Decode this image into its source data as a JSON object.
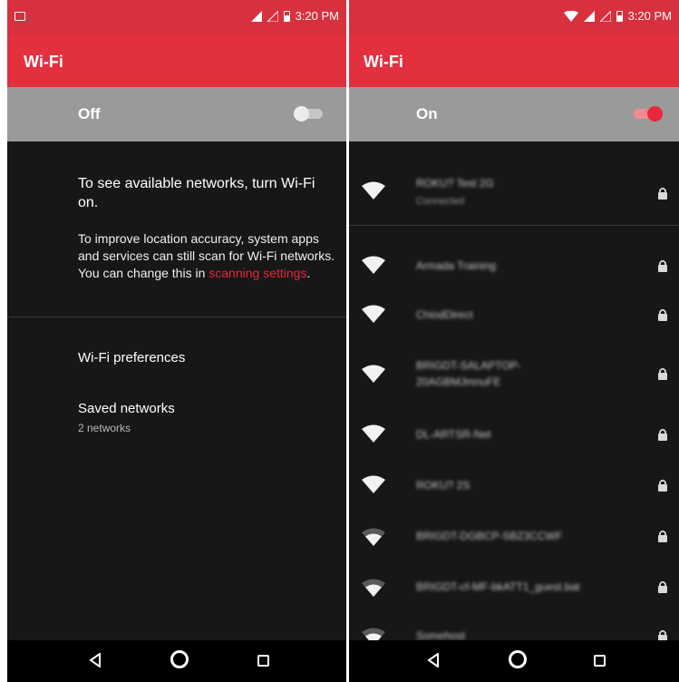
{
  "left_screen": {
    "status_bar": {
      "time": "3:20 PM",
      "icons": [
        "image-notification-icon",
        "signal-icon",
        "no-signal-icon",
        "battery-icon"
      ]
    },
    "app_bar": {
      "title": "Wi-Fi"
    },
    "master_switch": {
      "label": "Off",
      "state": "off"
    },
    "message_main": "To see available networks, turn Wi-Fi on.",
    "message_scan_prefix": "To improve location accuracy, system apps and services can still scan for Wi-Fi networks. You can change this in ",
    "message_scan_link": "scanning settings",
    "message_scan_suffix": ".",
    "preferences": {
      "label": "Wi-Fi preferences"
    },
    "saved_networks": {
      "label": "Saved networks",
      "subtitle": "2 networks"
    },
    "nav_bar": {
      "icons": [
        "back-icon",
        "home-icon",
        "recents-icon"
      ]
    }
  },
  "right_screen": {
    "status_bar": {
      "time": "3:20 PM",
      "icons": [
        "wifi-status-icon",
        "signal-icon",
        "no-signal-icon",
        "battery-icon"
      ]
    },
    "app_bar": {
      "title": "Wi-Fi"
    },
    "master_switch": {
      "label": "On",
      "state": "on"
    },
    "networks": [
      {
        "name": "ROKU? Test 2G",
        "status": "Connected",
        "signal": "full",
        "secured": true
      },
      {
        "name": "Armada Training",
        "signal": "full",
        "secured": true
      },
      {
        "name": "ChiodDirect",
        "signal": "full",
        "secured": true
      },
      {
        "name": "BRIGDT-SALAPTOP-",
        "name_line2": "20AGBMJmnuFE",
        "signal": "full",
        "secured": true
      },
      {
        "name": "DL-ARTSR-Net",
        "signal": "full",
        "secured": true
      },
      {
        "name": "ROKU? 2S",
        "signal": "full",
        "secured": true
      },
      {
        "name": "BRIGDT-DGBCP-SBZ3CCWF",
        "signal": "medium",
        "secured": true
      },
      {
        "name": "BRIGDT-cf-MF-bkATT1_guest.bat",
        "signal": "medium",
        "secured": true
      },
      {
        "name": "Somehost",
        "signal": "medium",
        "secured": true
      }
    ],
    "nav_bar": {
      "icons": [
        "back-icon",
        "home-icon",
        "recents-icon"
      ]
    }
  },
  "colors": {
    "accent": "#e3303f",
    "status_bar": "#d8303d",
    "switch_row": "#9a9a9a",
    "background": "#171717",
    "nav_bar": "#000000",
    "link": "#e8283a"
  }
}
